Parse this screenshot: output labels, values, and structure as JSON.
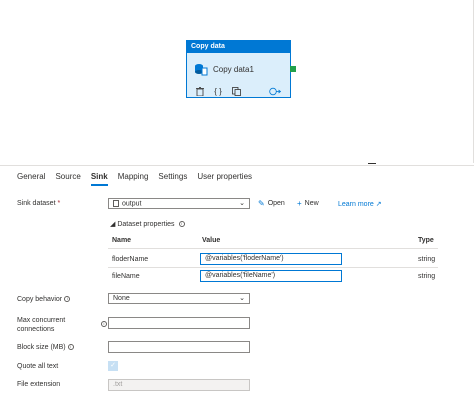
{
  "activity": {
    "header": "Copy data",
    "name": "Copy data1"
  },
  "tabs": [
    "General",
    "Source",
    "Sink",
    "Mapping",
    "Settings",
    "User properties"
  ],
  "sink": {
    "dataset_label": "Sink dataset",
    "required_marker": "*",
    "dataset_value": "output",
    "open_label": "Open",
    "new_label": "New",
    "learn_more_label": "Learn more",
    "dataset_properties_label": "Dataset properties",
    "columns": [
      "Name",
      "Value",
      "Type"
    ],
    "properties": [
      {
        "name": "floderName",
        "value": "@variables('floderName')",
        "type": "string"
      },
      {
        "name": "fileName",
        "value": "@variables('fileName')",
        "type": "string"
      }
    ],
    "copy_behavior_label": "Copy behavior",
    "copy_behavior_value": "None",
    "max_concurrent_label_1": "Max concurrent",
    "max_concurrent_label_2": "connections",
    "block_size_label": "Block size (MB)",
    "quote_all_text_label": "Quote all text",
    "quote_all_text_checked": true,
    "file_extension_label": "File extension",
    "file_extension_placeholder": ".txt"
  },
  "colors": {
    "accent": "#0078d4",
    "connector": "#22a04b",
    "checkbox_disabled": "#c7e0f4"
  },
  "icons": {
    "delete": "trash-icon",
    "code": "code-braces-icon",
    "clone": "copy-icon",
    "go": "arrow-right-circle-icon",
    "dataset": "dataset-icon",
    "open": "pencil-icon",
    "new": "plus-icon",
    "learn_more": "external-link-icon"
  }
}
